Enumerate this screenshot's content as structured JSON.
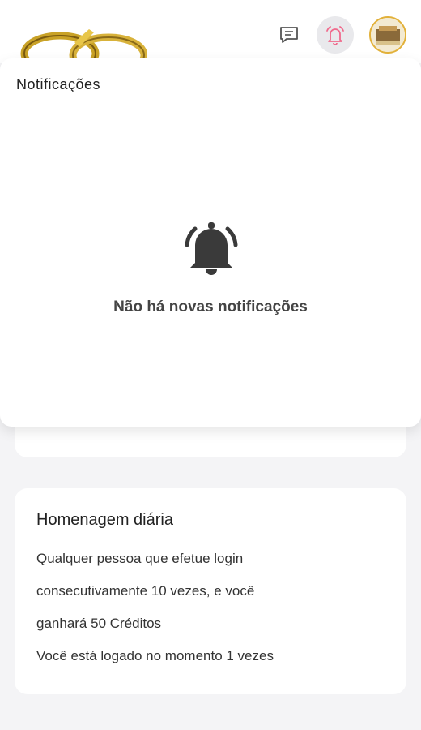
{
  "header": {
    "logo_icon": "wedding-rings-logo",
    "chat_icon": "chat-icon",
    "bell_icon": "alarm-bell-icon",
    "accent_color": "#f06a8c",
    "avatar_border_color": "#e2b13a"
  },
  "notifications": {
    "title": "Notificações",
    "empty_icon": "ringing-bell-icon",
    "empty_message": "Não há novas notificações"
  },
  "daily_tribute": {
    "title": "Homenagem diária",
    "line1": "Qualquer pessoa que efetue login",
    "line2": "consecutivamente 10 vezes, e você",
    "line3": "ganhará 50 Créditos",
    "line4": "Você está logado no momento 1 vezes"
  }
}
